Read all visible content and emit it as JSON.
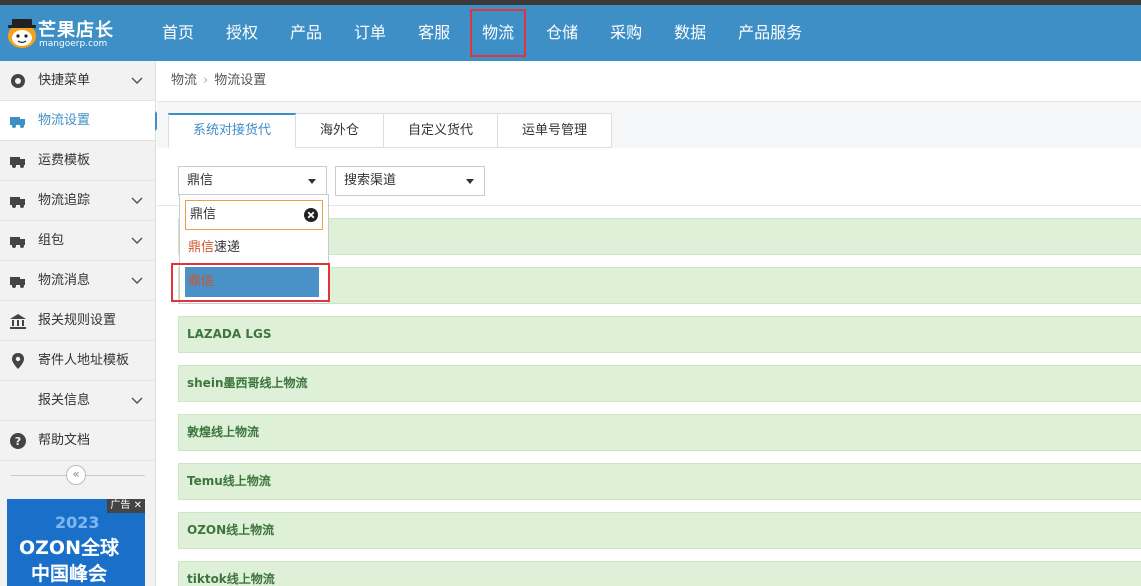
{
  "brand": {
    "name": "芒果店长",
    "domain": "mangoerp.com"
  },
  "nav": {
    "items": [
      {
        "label": "首页"
      },
      {
        "label": "授权"
      },
      {
        "label": "产品"
      },
      {
        "label": "订单"
      },
      {
        "label": "客服"
      },
      {
        "label": "物流",
        "highlighted": true
      },
      {
        "label": "仓储"
      },
      {
        "label": "采购"
      },
      {
        "label": "数据"
      },
      {
        "label": "产品服务"
      }
    ]
  },
  "sidebar": {
    "items": [
      {
        "label": "快捷菜单",
        "icon": "dashboard-icon",
        "expandable": true
      },
      {
        "label": "物流设置",
        "icon": "truck-icon",
        "active": true
      },
      {
        "label": "运费模板",
        "icon": "truck-icon"
      },
      {
        "label": "物流追踪",
        "icon": "truck-icon",
        "expandable": true
      },
      {
        "label": "组包",
        "icon": "truck-icon",
        "expandable": true
      },
      {
        "label": "物流消息",
        "icon": "truck-icon",
        "expandable": true
      },
      {
        "label": "报关规则设置",
        "icon": "bank-icon"
      },
      {
        "label": "寄件人地址模板",
        "icon": "location-pin-icon"
      },
      {
        "label": "报关信息",
        "icon": "",
        "expandable": true
      },
      {
        "label": "帮助文档",
        "icon": "question-icon"
      }
    ],
    "collapse_glyph": "«",
    "ad": {
      "tag": "广告",
      "year": "2023",
      "line1": "OZON全球",
      "line2": "中国峰会"
    }
  },
  "breadcrumb": {
    "parent": "物流",
    "current": "物流设置"
  },
  "tabs": [
    {
      "label": "系统对接货代",
      "active": true
    },
    {
      "label": "海外仓"
    },
    {
      "label": "自定义货代"
    },
    {
      "label": "运单号管理"
    }
  ],
  "filters": {
    "forwarder_select": "鼎信",
    "channel_select": "搜索渠道"
  },
  "dropdown": {
    "search_value": "鼎信",
    "options": [
      {
        "match": "鼎信",
        "rest": "速递"
      },
      {
        "match": "鼎信",
        "rest": "",
        "selected": true
      }
    ]
  },
  "rows": [
    {
      "label": ""
    },
    {
      "label": ""
    },
    {
      "label": "LAZADA LGS"
    },
    {
      "label": "shein墨西哥线上物流"
    },
    {
      "label": "敦煌线上物流"
    },
    {
      "label": "Temu线上物流"
    },
    {
      "label": "OZON线上物流"
    },
    {
      "label": "tiktok线上物流"
    }
  ],
  "colors": {
    "topbar": "#3d8fc6",
    "highlight_box": "#e0353a",
    "row_bg": "#dff0d8",
    "row_text": "#3c763d",
    "match_text": "#d2532c"
  }
}
